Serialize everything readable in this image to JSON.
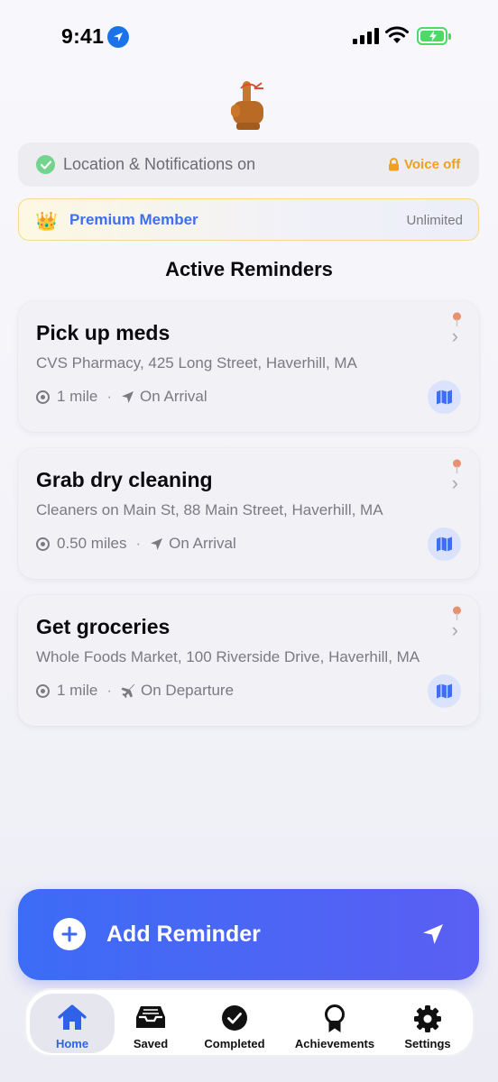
{
  "status_bar": {
    "time": "9:41",
    "icons": [
      "location-arrow-icon",
      "cellular-signal-icon",
      "wifi-icon",
      "battery-charging-icon"
    ]
  },
  "hero": {
    "icon": "crossed-finger-with-string-icon"
  },
  "status_card": {
    "text": "Location & Notifications on",
    "voice_label": "Voice off",
    "icons": [
      "check-circle-icon",
      "lock-icon"
    ],
    "accent": "#f0a020"
  },
  "premium": {
    "label": "Premium Member",
    "badge": "Unlimited",
    "icon": "crown-icon",
    "accent": "#3d6ff0"
  },
  "section_title": "Active Reminders",
  "reminders": [
    {
      "title": "Pick up meds",
      "address": "CVS Pharmacy, 425 Long Street, Haverhill, MA",
      "distance": "1 mile",
      "trigger": "On Arrival",
      "trigger_icon": "arrival-arrow-icon"
    },
    {
      "title": "Grab dry cleaning",
      "address": "Cleaners on Main St, 88 Main Street, Haverhill, MA",
      "distance": "0.50 miles",
      "trigger": "On Arrival",
      "trigger_icon": "arrival-arrow-icon"
    },
    {
      "title": "Get groceries",
      "address": "Whole Foods Market, 100 Riverside Drive, Haverhill, MA",
      "distance": "1 mile",
      "trigger": "On Departure",
      "trigger_icon": "departure-plane-icon"
    }
  ],
  "add_button": {
    "label": "Add Reminder",
    "colors": [
      "#3c6cf6",
      "#5a5ff3"
    ]
  },
  "tabs": [
    {
      "label": "Home",
      "icon": "home-icon",
      "active": true
    },
    {
      "label": "Saved",
      "icon": "tray-icon",
      "active": false
    },
    {
      "label": "Completed",
      "icon": "checkmark-circle-icon",
      "active": false
    },
    {
      "label": "Achievements",
      "icon": "ribbon-icon",
      "active": false
    },
    {
      "label": "Settings",
      "icon": "gear-icon",
      "active": false
    }
  ]
}
